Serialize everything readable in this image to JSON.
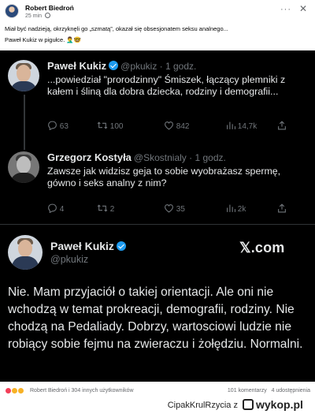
{
  "post": {
    "author": "Robert Biedroń",
    "time": "25 min",
    "more_label": "···",
    "close_label": "✕",
    "text_line1": "Miał być nadzieją, okrzyknęli go „szmatą”, okazał się obsesjonatem seksu analnego...",
    "text_line2": "Paweł Kukiz w pigułce. 🤦‍♂️🤓"
  },
  "tweets": [
    {
      "name": "Paweł Kukiz",
      "handle": "@pkukiz · 1 godz.",
      "text": "...powiedział \"prorodzinny\" Śmiszek, łączący plemniki z kałem i śliną dla dobra dziecka, rodziny i demografii...",
      "replies": "63",
      "retweets": "100",
      "likes": "842",
      "views": "14,7k"
    },
    {
      "name": "Grzegorz Kostyła",
      "handle": "@Skostnialy · 1 godz.",
      "text": "Zawsze jak widzisz geja to sobie wyobrażasz spermę, gówno i seks analny z nim?",
      "replies": "4",
      "retweets": "2",
      "likes": "35",
      "views": "2k"
    }
  ],
  "main_tweet": {
    "name": "Paweł Kukiz",
    "handle": "@pkukiz",
    "brand": "𝕏.com",
    "text": "Nie. Mam przyjaciół o takiej orientacji. Ale oni nie wchodzą w  temat prokreacji, demografii, rodziny. Nie chodzą na Pedaliady. Dobrzy, wartosciowi ludzie nie robiący sobie fejmu na zwieraczu i żołędziu. Normalni."
  },
  "reactions": {
    "label": "Robert Biedroń i 304 innych użytkowników",
    "comments": "101 komentarzy",
    "shares": "4 udostępnienia"
  },
  "watermark": {
    "user": "CipakKrulRzycia",
    "separator": "z",
    "site": "wykop.pl"
  },
  "colors": {
    "twitter_bg": "#000000",
    "verified_blue": "#1d9bf0",
    "text_light": "#e7e9ea",
    "muted": "#71767b"
  }
}
